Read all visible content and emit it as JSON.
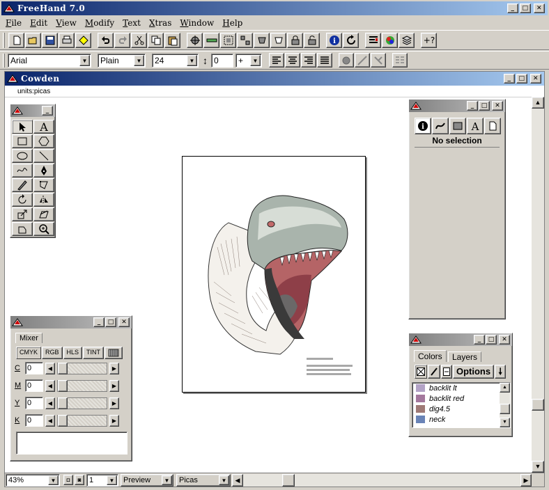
{
  "app": {
    "title": "FreeHand 7.0"
  },
  "menu": [
    "File",
    "Edit",
    "View",
    "Modify",
    "Text",
    "Xtras",
    "Window",
    "Help"
  ],
  "toolbar": {
    "buttons": [
      "new-icon",
      "open-icon",
      "save-icon",
      "print-icon",
      "import-icon",
      "undo-icon",
      "redo-icon",
      "cut-icon",
      "copy-icon",
      "paste-icon",
      "inspector-icon",
      "link-icon",
      "group-icon",
      "ungroup-icon",
      "join-icon",
      "split-icon",
      "lock-icon",
      "unlock-icon",
      "info-icon",
      "refresh-icon",
      "align-icon",
      "color-icon",
      "layers-icon",
      "help-icon"
    ]
  },
  "text_toolbar": {
    "font": "Arial",
    "style": "Plain",
    "size": "24",
    "leading": "0",
    "leading_mode": "+"
  },
  "document": {
    "title": "Cowden",
    "units": "units:picas"
  },
  "tools_panel": {
    "tools": [
      "pointer-tool",
      "text-tool",
      "rectangle-tool",
      "polygon-tool",
      "ellipse-tool",
      "line-tool",
      "freehand-tool",
      "pen-tool",
      "knife-tool",
      "bezigon-tool",
      "rotate-tool",
      "reflect-tool",
      "scale-tool",
      "skew-tool",
      "trace-tool",
      "zoom-tool"
    ]
  },
  "inspector": {
    "selection": "No selection"
  },
  "mixer": {
    "tab": "Mixer",
    "modes": [
      "CMYK",
      "RGB",
      "HLS",
      "TINT"
    ],
    "rows": [
      {
        "label": "C",
        "value": "0"
      },
      {
        "label": "M",
        "value": "0"
      },
      {
        "label": "Y",
        "value": "0"
      },
      {
        "label": "K",
        "value": "0"
      }
    ]
  },
  "colors_panel": {
    "tabs": [
      "Colors",
      "Layers"
    ],
    "options_label": "Options",
    "items": [
      {
        "name": "backlit lt",
        "color": "#b3a3c6"
      },
      {
        "name": "backlit red",
        "color": "#a4789d"
      },
      {
        "name": "dig4.5",
        "color": "#9f7a76"
      },
      {
        "name": "neck",
        "color": "#6a84b7"
      }
    ]
  },
  "status": {
    "zoom": "43%",
    "page": "1",
    "view_mode": "Preview",
    "units": "Picas"
  }
}
